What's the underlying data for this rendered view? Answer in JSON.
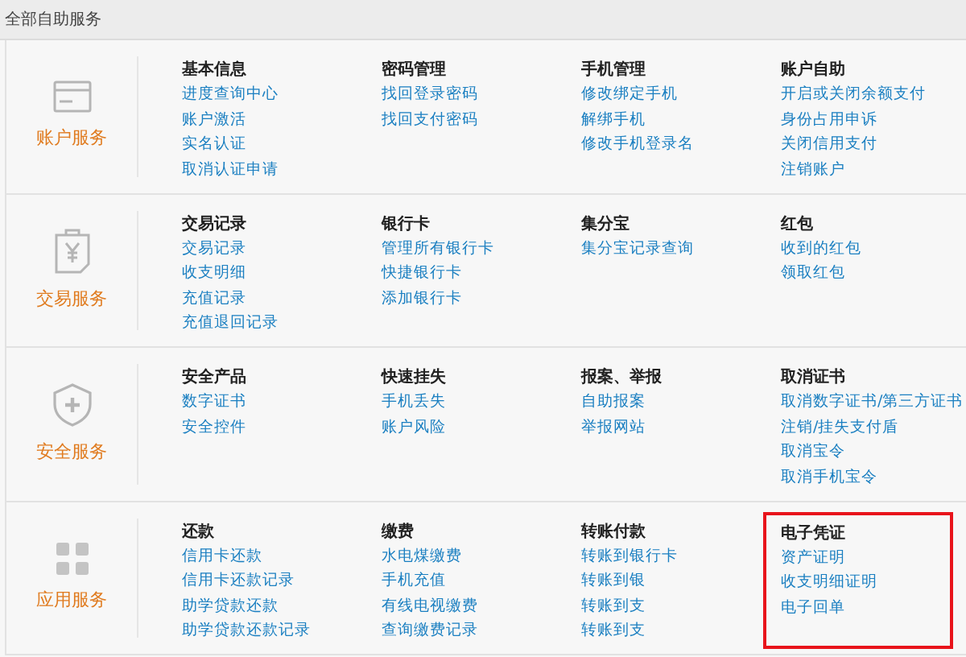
{
  "header": {
    "title": "全部自助服务"
  },
  "sections": [
    {
      "kind": "card",
      "label": "账户服务",
      "groups": [
        {
          "heading": "基本信息",
          "links": [
            "进度查询中心",
            "账户激活",
            "实名认证",
            "取消认证申请"
          ]
        },
        {
          "heading": "密码管理",
          "links": [
            "找回登录密码",
            "找回支付密码"
          ]
        },
        {
          "heading": "手机管理",
          "links": [
            "修改绑定手机",
            "解绑手机",
            "修改手机登录名"
          ]
        },
        {
          "heading": "账户自助",
          "links": [
            "开启或关闭余额支付",
            "身份占用申诉",
            "关闭信用支付",
            "注销账户"
          ]
        }
      ]
    },
    {
      "kind": "receipt",
      "label": "交易服务",
      "groups": [
        {
          "heading": "交易记录",
          "links": [
            "交易记录",
            "收支明细",
            "充值记录",
            "充值退回记录"
          ]
        },
        {
          "heading": "银行卡",
          "links": [
            "管理所有银行卡",
            "快捷银行卡",
            "添加银行卡"
          ]
        },
        {
          "heading": "集分宝",
          "links": [
            "集分宝记录查询"
          ]
        },
        {
          "heading": "红包",
          "links": [
            "收到的红包",
            "领取红包"
          ]
        }
      ]
    },
    {
      "kind": "shield",
      "label": "安全服务",
      "groups": [
        {
          "heading": "安全产品",
          "links": [
            "数字证书",
            "安全控件"
          ]
        },
        {
          "heading": "快速挂失",
          "links": [
            "手机丢失",
            "账户风险"
          ]
        },
        {
          "heading": "报案、举报",
          "links": [
            "自助报案",
            "举报网站"
          ]
        },
        {
          "heading": "取消证书",
          "links": [
            "取消数字证书/第三方证书",
            "注销/挂失支付盾",
            "取消宝令",
            "取消手机宝令"
          ]
        }
      ]
    },
    {
      "kind": "grid",
      "label": "应用服务",
      "groups": [
        {
          "heading": "还款",
          "links": [
            "信用卡还款",
            "信用卡还款记录",
            "助学贷款还款",
            "助学贷款还款记录"
          ]
        },
        {
          "heading": "缴费",
          "links": [
            "水电煤缴费",
            "手机充值",
            "有线电视缴费",
            "查询缴费记录"
          ]
        },
        {
          "heading": "转账付款",
          "links": [
            "转账到银行卡",
            "转账到银",
            "转账到支",
            "转账到支"
          ]
        },
        {
          "heading": "电子凭证",
          "highlighted": true,
          "links": [
            "资产证明",
            "收支明细证明",
            "电子回单"
          ]
        }
      ]
    }
  ]
}
